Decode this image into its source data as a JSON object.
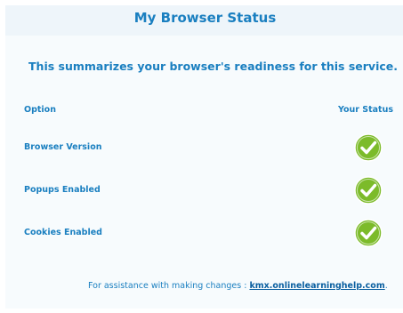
{
  "header": {
    "title": "My Browser Status"
  },
  "summary": "This summarizes your browser's readiness for this service.",
  "table": {
    "option_header": "Option",
    "status_header": "Your Status",
    "rows": [
      {
        "label": "Browser Version",
        "status_icon": "green-check-icon"
      },
      {
        "label": "Popups Enabled",
        "status_icon": "green-check-icon"
      },
      {
        "label": "Cookies Enabled",
        "status_icon": "green-check-icon"
      }
    ]
  },
  "footer": {
    "prefix": "For assistance with making changes :",
    "link_text": "kmx.onlinelearninghelp.com",
    "suffix": "."
  },
  "colors": {
    "accent": "#1a7fc0",
    "check_green": "#7cbb2a",
    "panel_bg": "#f7fbfd"
  }
}
